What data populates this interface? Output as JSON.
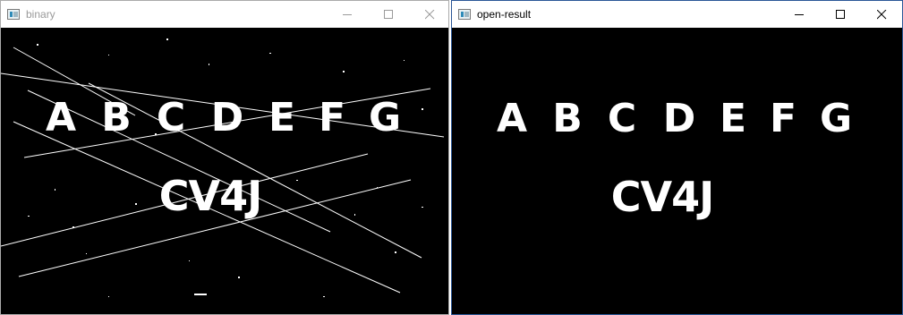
{
  "windows": [
    {
      "title": "binary",
      "state": "inactive",
      "letters": [
        "A",
        "B",
        "C",
        "D",
        "E",
        "F",
        "G"
      ],
      "word": "CV4J",
      "icons": {
        "app": "app-icon",
        "minimize": "minimize-icon",
        "maximize": "maximize-icon",
        "close": "close-icon"
      }
    },
    {
      "title": "open-result",
      "state": "active",
      "letters": [
        "A",
        "B",
        "C",
        "D",
        "E",
        "F",
        "G"
      ],
      "word": "CV4J",
      "icons": {
        "app": "app-icon",
        "minimize": "minimize-icon",
        "maximize": "maximize-icon",
        "close": "close-icon"
      }
    }
  ],
  "colors": {
    "canvas": "#000000",
    "glyph": "#ffffff",
    "active_border": "#2b5797",
    "inactive_title": "#9a9a9a"
  }
}
